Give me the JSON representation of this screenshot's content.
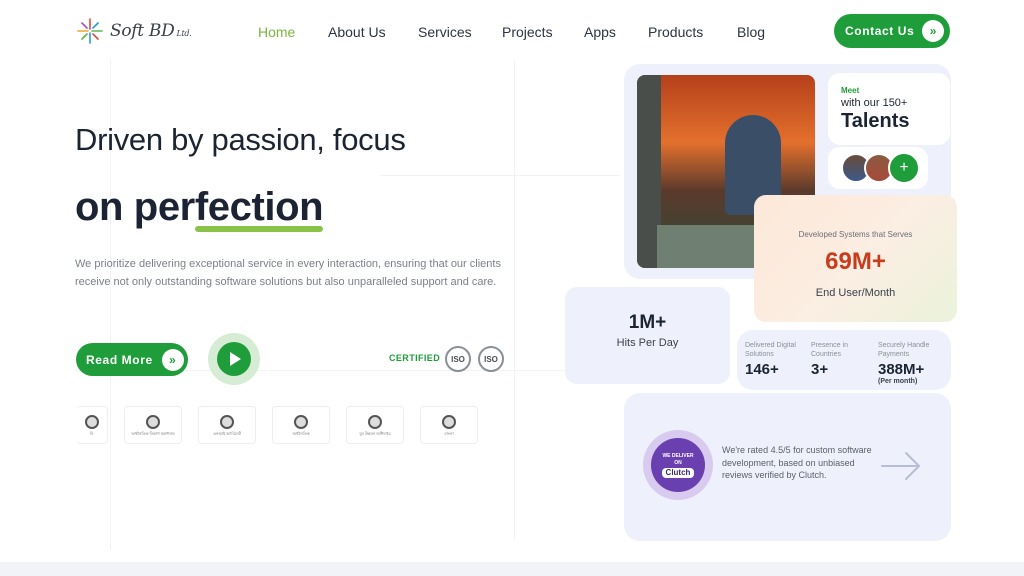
{
  "brand": {
    "name": "Soft BD",
    "suffix": "Ltd."
  },
  "nav": {
    "items": [
      {
        "label": "Home",
        "active": true
      },
      {
        "label": "About Us"
      },
      {
        "label": "Services"
      },
      {
        "label": "Projects"
      },
      {
        "label": "Apps"
      },
      {
        "label": "Products"
      },
      {
        "label": "Blog"
      }
    ],
    "contact_label": "Contact Us"
  },
  "hero": {
    "line1": "Driven by passion, focus",
    "line2_prefix": "on per",
    "line2_highlight": "fection",
    "description": "We prioritize delivering exceptional service in every interaction, ensuring that our clients receive not only outstanding software solutions but also unparalleled support and care.",
    "read_more_label": "Read More",
    "certified_label": "CERTIFIED",
    "iso_labels": [
      "ISO",
      "ISO"
    ]
  },
  "partners": [
    {
      "caption": "বি"
    },
    {
      "caption": "অর্থনৈতিক বিভাগ মন্ত্রণালয়"
    },
    {
      "caption": "এনআই ক্যাবিনেট"
    },
    {
      "caption": "অর্থনৈতিক"
    },
    {
      "caption": "যুব উন্নয়ন অধিদপ্তর"
    },
    {
      "caption": "বাংলা"
    }
  ],
  "talents": {
    "meet": "Meet",
    "with": "with our 150+",
    "title": "Talents",
    "add_symbol": "+"
  },
  "users": {
    "caption": "Developed Systems that Serves",
    "value": "69M+",
    "unit": "End User/Month"
  },
  "hits": {
    "value": "1M+",
    "label": "Hits Per Day"
  },
  "stats": [
    {
      "caption": "Delivered Digital Solutions",
      "value": "146+",
      "note": ""
    },
    {
      "caption": "Presence in Countries",
      "value": "3+",
      "note": ""
    },
    {
      "caption": "Securely Handle Payments",
      "value": "388M+",
      "note": "(Per month)"
    }
  ],
  "clutch": {
    "badge_top": "WE DELIVER",
    "badge_mid": "ON",
    "badge_name": "Clutch",
    "text": "We're rated 4.5/5 for custom software development, based on unbiased reviews verified by Clutch."
  },
  "colors": {
    "accent": "#1f9d3a",
    "nav_active": "#7cb342",
    "highlight": "#c83c1e"
  }
}
